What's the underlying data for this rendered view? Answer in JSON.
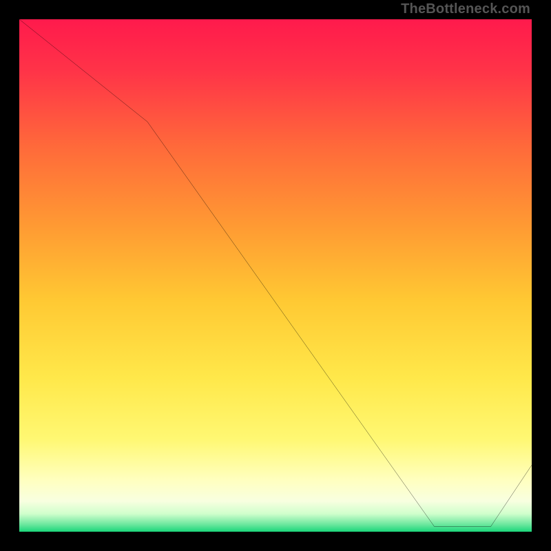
{
  "watermark": "TheBottleneck.com",
  "flat_label": "",
  "chart_data": {
    "type": "line",
    "title": "",
    "xlabel": "",
    "ylabel": "",
    "xlim": [
      0,
      100
    ],
    "ylim": [
      0,
      100
    ],
    "grid": false,
    "legend": false,
    "series": [
      {
        "name": "curve",
        "x": [
          0,
          25,
          81,
          86,
          92,
          100
        ],
        "values": [
          100,
          80,
          1,
          1,
          1,
          13
        ]
      }
    ],
    "gradient_stops": [
      {
        "offset": 0.0,
        "color": "#ff1a4c"
      },
      {
        "offset": 0.1,
        "color": "#ff3348"
      },
      {
        "offset": 0.25,
        "color": "#ff6a3a"
      },
      {
        "offset": 0.4,
        "color": "#ff9933"
      },
      {
        "offset": 0.55,
        "color": "#ffc933"
      },
      {
        "offset": 0.7,
        "color": "#ffe84a"
      },
      {
        "offset": 0.82,
        "color": "#fff873"
      },
      {
        "offset": 0.9,
        "color": "#ffffc0"
      },
      {
        "offset": 0.94,
        "color": "#f8ffe0"
      },
      {
        "offset": 0.965,
        "color": "#d0ffcc"
      },
      {
        "offset": 0.985,
        "color": "#70e8a0"
      },
      {
        "offset": 1.0,
        "color": "#1ad67a"
      }
    ],
    "flat_segment": {
      "x_start": 81,
      "x_end": 92,
      "y": 1
    }
  }
}
